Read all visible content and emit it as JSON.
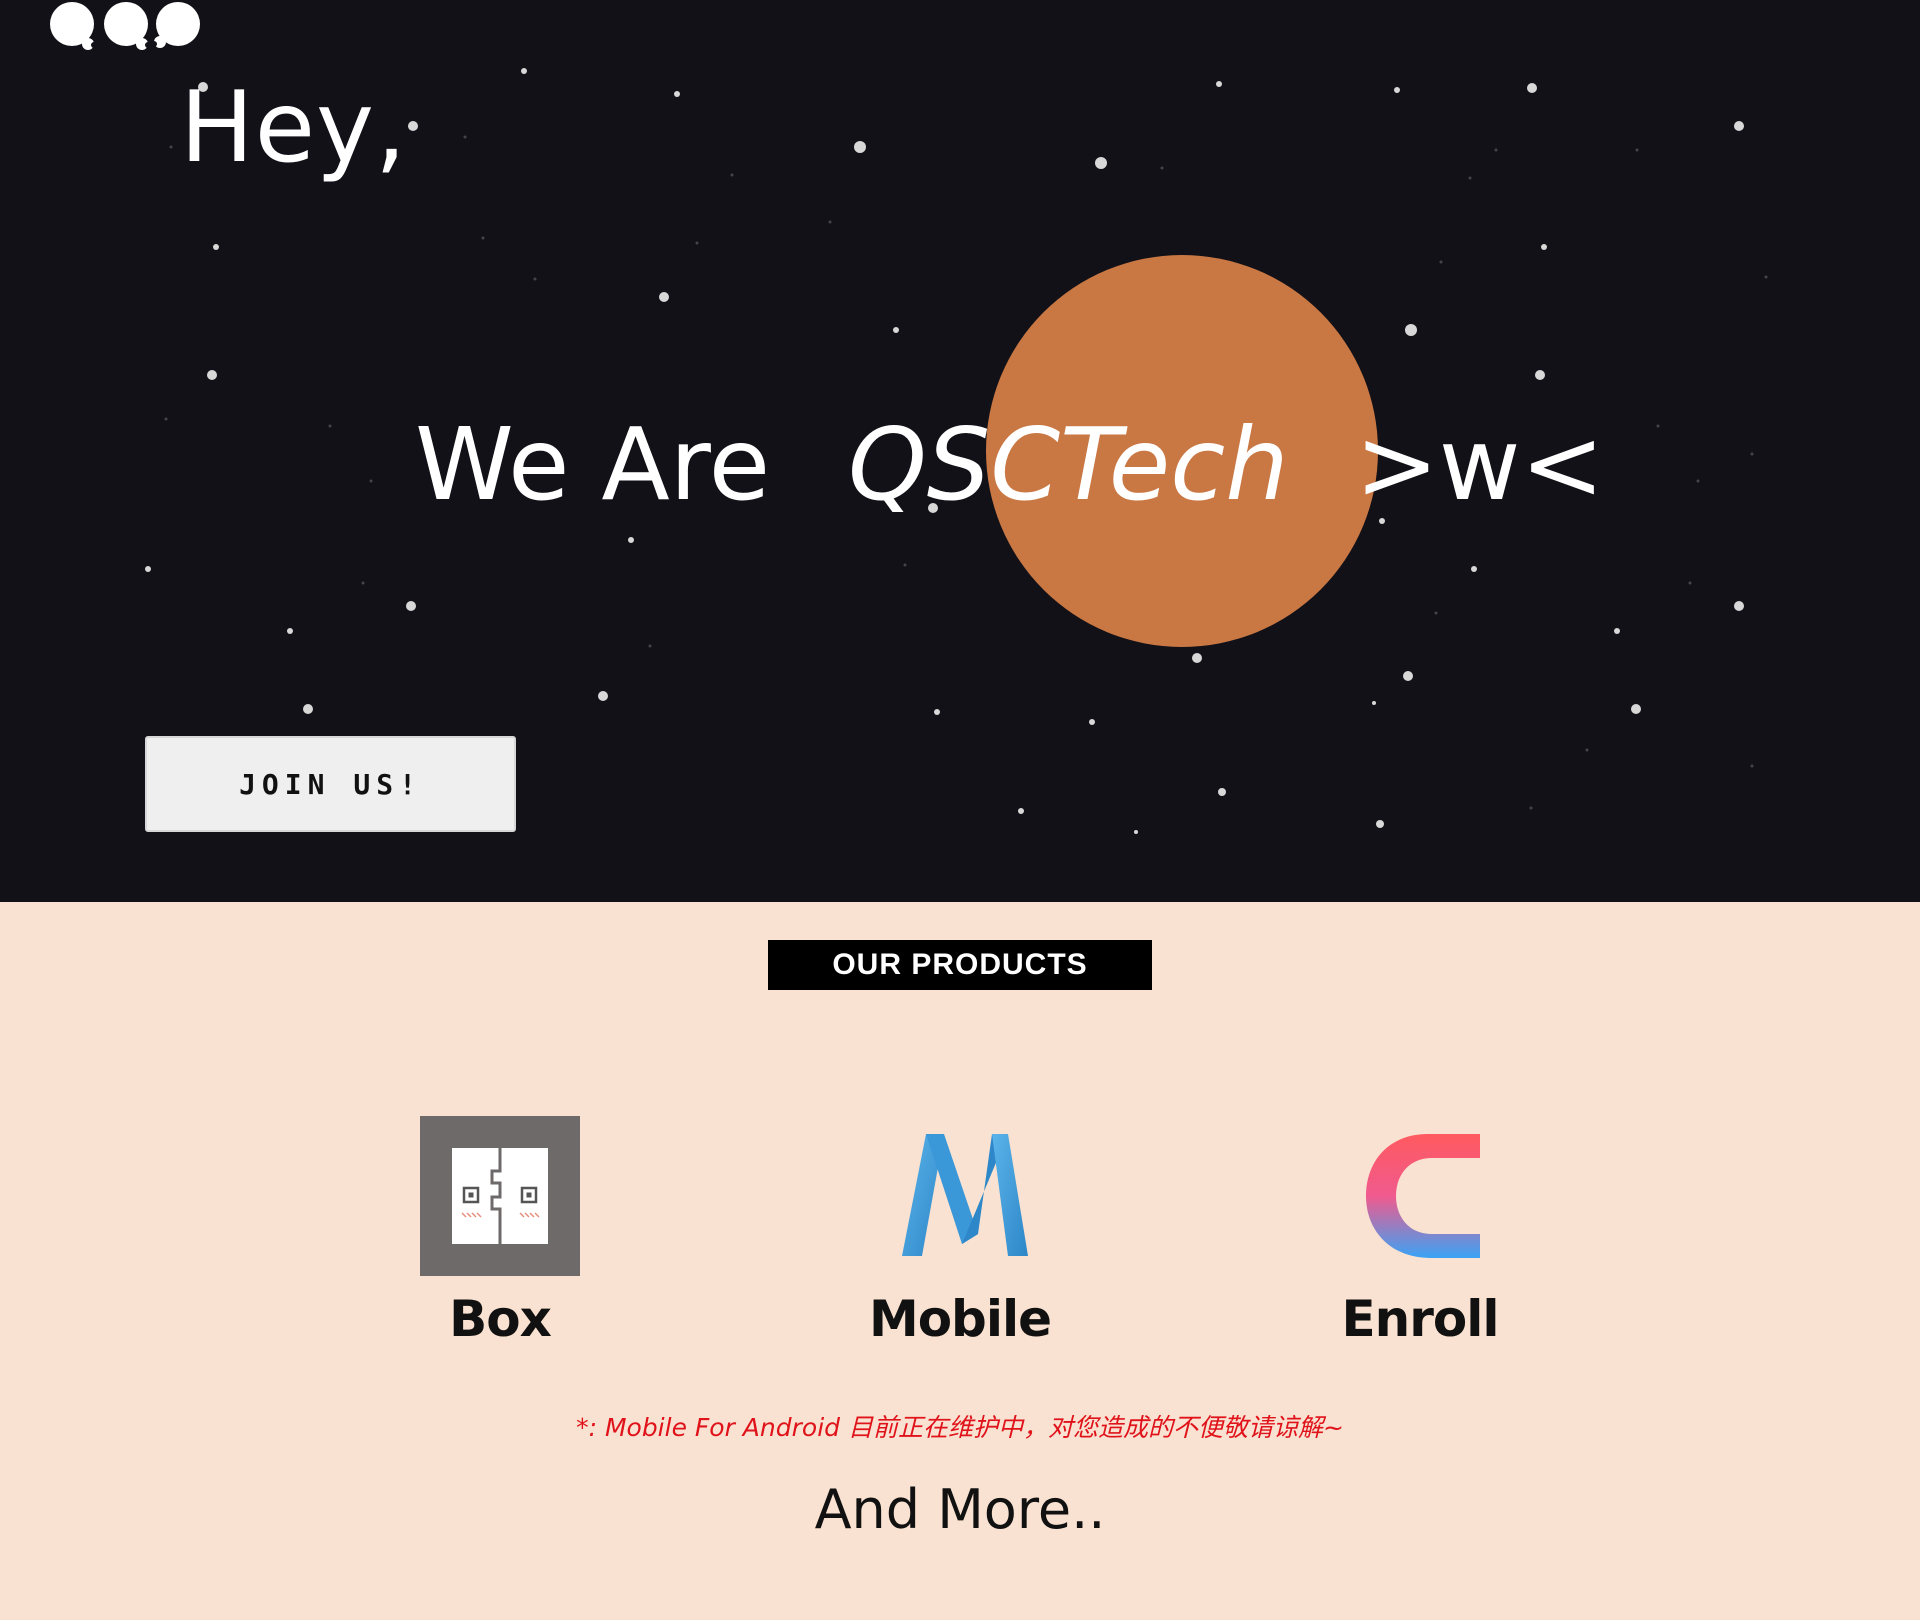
{
  "header": {
    "logo_icon": "three-bubbles-logo-icon",
    "greeting": "Hey,",
    "headline_prefix": "We Are",
    "brand": "QSCTech",
    "emoticon": ">w<",
    "join_button_label": "JOIN US!"
  },
  "products_section": {
    "label": "OUR PRODUCTS",
    "items": [
      {
        "name": "Box",
        "icon": "box-qr-icon"
      },
      {
        "name": "Mobile",
        "icon": "mobile-m-icon"
      },
      {
        "name": "Enroll",
        "icon": "enroll-c-icon"
      }
    ],
    "notice": "*: Mobile For Android 目前正在维护中，对您造成的不便敬请谅解~",
    "more": "And More.."
  },
  "colors": {
    "hero_background": "#121118",
    "planet": "#c97743",
    "products_background": "#f9e2d1",
    "notice_text": "#e0131b"
  }
}
